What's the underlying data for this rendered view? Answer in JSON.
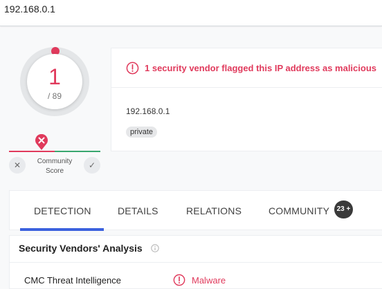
{
  "topbar": {
    "search_value": "192.168.0.1"
  },
  "score": {
    "detections": "1",
    "total": "/ 89"
  },
  "community_score": {
    "label": "Community Score",
    "dislike_icon": "x-icon",
    "like_icon": "check-icon",
    "marker_icon": "red-x-marker-icon"
  },
  "alert": {
    "icon": "exclamation-circle-icon",
    "text": "1 security vendor flagged this IP address as malicious"
  },
  "ip_info": {
    "address": "192.168.0.1",
    "tags": [
      "private"
    ]
  },
  "tabs": [
    {
      "label": "DETECTION",
      "active": true
    },
    {
      "label": "DETAILS"
    },
    {
      "label": "RELATIONS"
    },
    {
      "label": "COMMUNITY",
      "badge": "23 +"
    }
  ],
  "analysis": {
    "title": "Security Vendors' Analysis",
    "info_icon": "info-icon",
    "rows": [
      {
        "vendor": "CMC Threat Intelligence",
        "result": "Malware",
        "result_icon": "exclamation-circle-icon"
      }
    ]
  },
  "colors": {
    "malicious": "#e03a5c",
    "clean": "#39a76f",
    "accent": "#3b61de"
  }
}
